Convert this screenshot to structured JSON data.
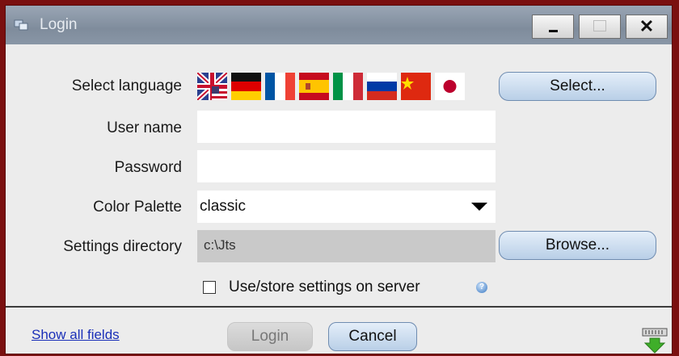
{
  "window": {
    "title": "Login"
  },
  "language": {
    "label": "Select language",
    "flags": [
      "uk-us-flag-icon",
      "german-flag-icon",
      "french-flag-icon",
      "spanish-flag-icon",
      "italian-flag-icon",
      "russian-flag-icon",
      "chinese-flag-icon",
      "japanese-flag-icon"
    ],
    "select_button": "Select..."
  },
  "username": {
    "label": "User name",
    "value": ""
  },
  "password": {
    "label": "Password",
    "value": ""
  },
  "palette": {
    "label": "Color Palette",
    "value": "classic"
  },
  "settings_dir": {
    "label": "Settings directory",
    "value": "c:\\Jts",
    "browse_button": "Browse..."
  },
  "store_on_server": {
    "label": "Use/store settings on server",
    "checked": false
  },
  "footer": {
    "show_all_link": "Show all fields",
    "login_button": "Login",
    "cancel_button": "Cancel"
  },
  "colors": {
    "background": "#7a1010",
    "titlebar": "#8996a6",
    "button": "#b9cfe7"
  }
}
